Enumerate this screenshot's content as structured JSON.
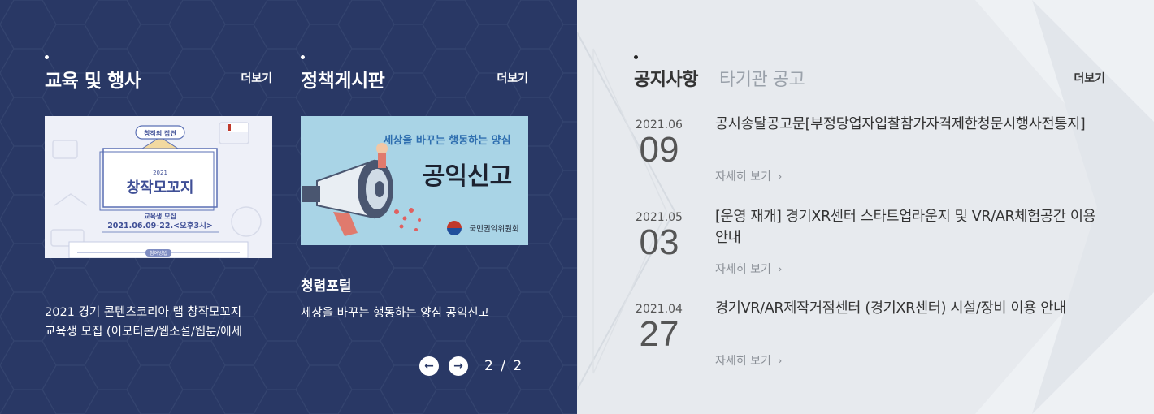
{
  "education": {
    "title": "교육 및 행사",
    "more": "더보기",
    "thumb": {
      "badge": "창작의 잡견",
      "year": "2021",
      "headline": "창작모꼬지",
      "sub": "교육생 모집",
      "date": "2021.06.09-22.<오후3시>",
      "join": "참여방법"
    },
    "caption_line1": "2021 경기 콘텐츠코리아 랩 창작모꼬지",
    "caption_line2": "교육생 모집 (이모티콘/웹소설/웹툰/에세"
  },
  "policy": {
    "title": "정책게시판",
    "more": "더보기",
    "banner": {
      "tagline": "세상을 바꾸는 행동하는 양심",
      "headline": "공익신고",
      "org": "국민권익위원회"
    },
    "item_title": "청렴포털",
    "item_desc": "세상을 바꾸는 행동하는 양심 공익신고",
    "pager": {
      "prev": "←",
      "next": "→",
      "current": "2",
      "sep": "/",
      "total": "2"
    }
  },
  "notice": {
    "tabs": [
      "공지사항",
      "타기관 공고"
    ],
    "more": "더보기",
    "detail_label": "자세히 보기",
    "items": [
      {
        "ym": "2021.06",
        "day": "09",
        "title": "공시송달공고문[부정당업자입찰참가자격제한청문시행사전통지]"
      },
      {
        "ym": "2021.05",
        "day": "03",
        "title": "[운영 재개] 경기XR센터 스타트업라운지 및 VR/AR체험공간 이용 안내"
      },
      {
        "ym": "2021.04",
        "day": "27",
        "title": "경기VR/AR제작거점센터 (경기XR센터) 시설/장비 이용 안내"
      }
    ]
  },
  "colors": {
    "left_bg": "#293865",
    "right_bg": "#e7eaee"
  }
}
